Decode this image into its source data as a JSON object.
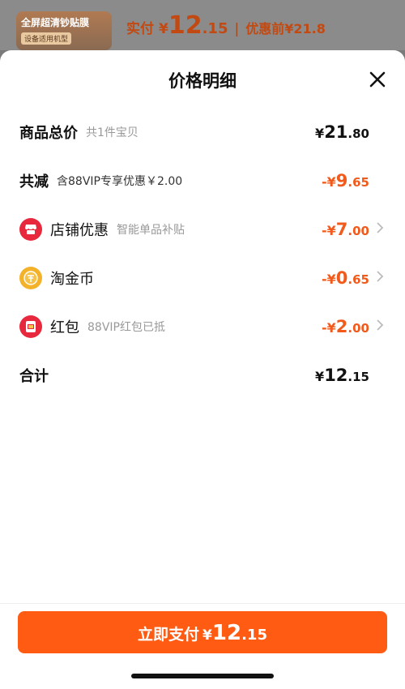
{
  "header_behind": {
    "thumb_title": "全屏超清钞贴膜",
    "thumb_sub": "设备适用机型",
    "paid_label": "实付",
    "paid_yen": "¥",
    "paid_int": "12",
    "paid_dec": ".15",
    "separator": "|",
    "original_label": "优惠前",
    "original_price": "¥21.8"
  },
  "sheet": {
    "title": "价格明细",
    "close_icon": "close-icon"
  },
  "rows": {
    "total": {
      "name": "商品总价",
      "sub": "共1件宝贝",
      "yen": "¥",
      "int": "21",
      "dec": ".80"
    },
    "reduce": {
      "name": "共减",
      "sub": "含88VIP专享优惠￥2.00",
      "yen": "-¥",
      "int": "9",
      "dec": ".65"
    },
    "shop": {
      "name": "店铺优惠",
      "sub": "智能单品补贴",
      "yen": "-¥",
      "int": "7",
      "dec": ".00",
      "icon": "shop-icon"
    },
    "coin": {
      "name": "淘金币",
      "sub": "",
      "yen": "-¥",
      "int": "0",
      "dec": ".65",
      "icon": "coin-icon"
    },
    "redpacket": {
      "name": "红包",
      "sub": "88VIP红包已抵",
      "yen": "-¥",
      "int": "2",
      "dec": ".00",
      "icon": "red-packet-icon"
    },
    "sum": {
      "name": "合计",
      "yen": "¥",
      "int": "12",
      "dec": ".15"
    }
  },
  "pay_button": {
    "label": "立即支付",
    "yen": "¥",
    "int": "12",
    "dec": ".15"
  },
  "colors": {
    "accent": "#ff5b12",
    "discount": "#f25a1c",
    "red_icon": "#e8283c",
    "coin": "#f4b12a"
  }
}
